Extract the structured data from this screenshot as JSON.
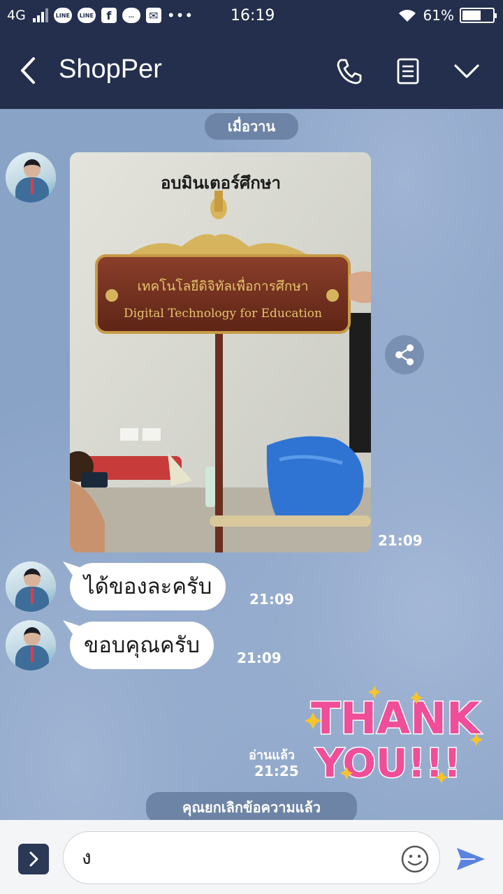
{
  "status_bar": {
    "network": "4G",
    "app_icons": [
      "LINE",
      "LINE",
      "f",
      "…",
      "✉"
    ],
    "time": "16:19",
    "battery_percent": "61%",
    "battery_level": 0.61
  },
  "header": {
    "title": "ShopPer",
    "back_icon": "chevron-left-icon",
    "call_icon": "phone-icon",
    "notes_icon": "note-icon",
    "menu_icon": "chevron-down-icon"
  },
  "chat": {
    "date_label": "เมื่อวาน",
    "messages": [
      {
        "type": "image",
        "time": "21:09"
      },
      {
        "type": "text",
        "text": "ได้ของละครับ",
        "time": "21:09"
      },
      {
        "type": "text",
        "text": "ขอบคุณครับ",
        "time": "21:09"
      },
      {
        "type": "sticker",
        "read_label": "อ่านแล้ว",
        "time": "21:25"
      }
    ],
    "photo_sign": {
      "top_text": "อบมินเตอร์ศึกษา",
      "thai_text": "เทคโนโลยีดิจิทัลเพื่อการศึกษา",
      "english_text": "Digital Technology for Education"
    },
    "sticker_text": {
      "line1": "THANK",
      "line2": "YOU!!!"
    },
    "unsent_notice": "คุณยกเลิกข้อความแล้ว"
  },
  "input_bar": {
    "value": "ง",
    "expand_icon": "chevron-right-icon",
    "emoji_icon": "smiley-icon",
    "send_icon": "send-icon"
  },
  "colors": {
    "header_bg": "#232f4c",
    "chat_bg": "#89a3c7",
    "pill_bg": "#6d84a6",
    "send_accent": "#5a82e0"
  }
}
